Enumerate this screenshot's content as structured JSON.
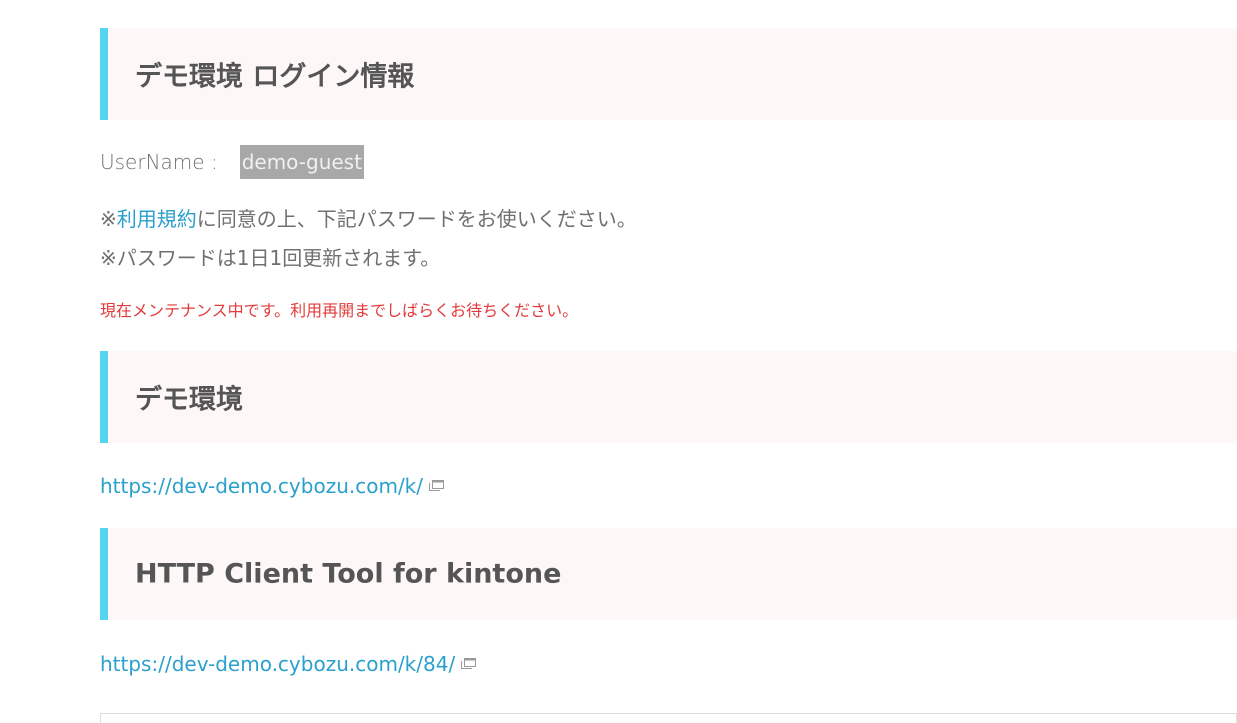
{
  "login_section": {
    "heading": "デモ環境 ログイン情報",
    "username_label": "UserName :",
    "username_value": "demo-guest",
    "note1_prefix": "※",
    "note1_link": "利用規約",
    "note1_suffix": "に同意の上、下記パスワードをお使いください。",
    "note2": "※パスワードは1日1回更新されます。",
    "maintenance_notice": "現在メンテナンス中です。利用再開までしばらくお待ちください。"
  },
  "demo_section": {
    "heading": "デモ環境",
    "link": "https://dev-demo.cybozu.com/k/"
  },
  "http_tool_section": {
    "heading": "HTTP Client Tool for kintone",
    "link": "https://dev-demo.cybozu.com/k/84/"
  },
  "colors": {
    "accent_border": "#55d4ef",
    "heading_bg": "#fdf8f7",
    "link": "#2aa0cc",
    "warning": "#e23b3b"
  },
  "icons": {
    "external_link": "external-link-icon"
  }
}
